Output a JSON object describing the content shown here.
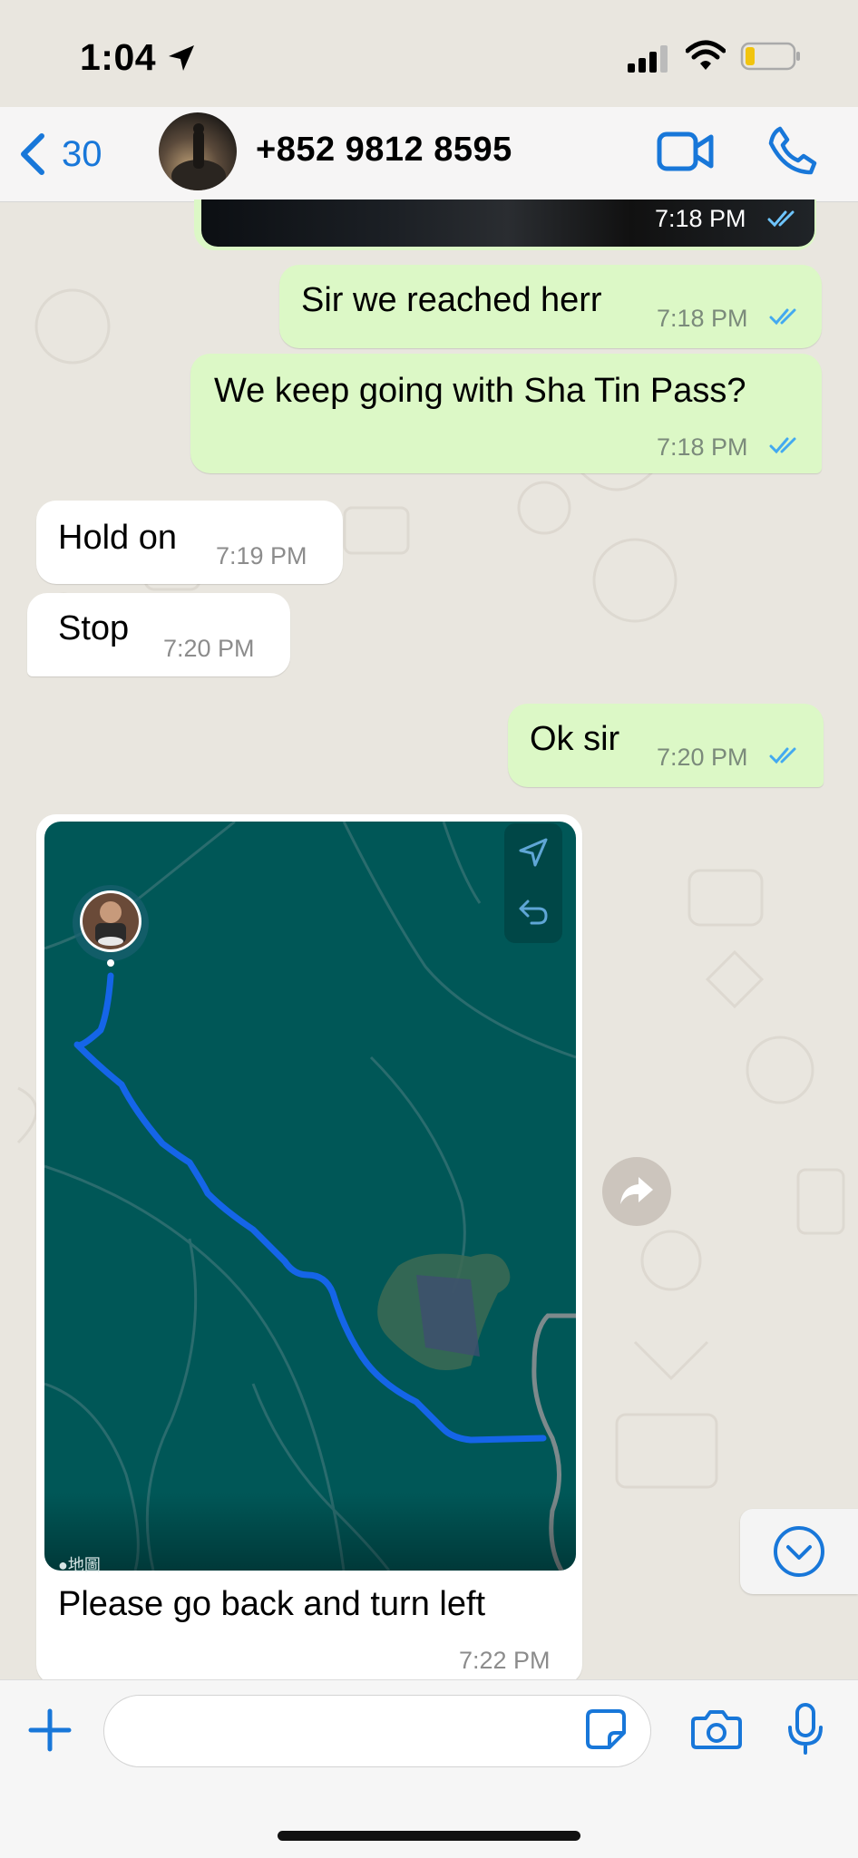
{
  "status_bar": {
    "time": "1:04"
  },
  "header": {
    "back_count": "30",
    "contact_name": "+852 9812 8595"
  },
  "messages": [
    {
      "id": "m0",
      "dir": "out",
      "type": "image",
      "time": "7:18 PM",
      "read": true
    },
    {
      "id": "m1",
      "dir": "out",
      "text": "Sir we reached herr",
      "time": "7:18 PM",
      "read": true
    },
    {
      "id": "m2",
      "dir": "out",
      "text": "We keep going with Sha Tin Pass?",
      "time": "7:18 PM",
      "read": true
    },
    {
      "id": "m3",
      "dir": "in",
      "text": "Hold on",
      "time": "7:19 PM"
    },
    {
      "id": "m4",
      "dir": "in",
      "text": "Stop",
      "time": "7:20 PM"
    },
    {
      "id": "m5",
      "dir": "out",
      "text": "Ok sir",
      "time": "7:20 PM",
      "read": true
    },
    {
      "id": "m6",
      "dir": "in",
      "type": "map-image",
      "caption": "Please go back and turn left",
      "time": "7:22 PM",
      "map_brand": "地圖"
    }
  ],
  "composer": {
    "placeholder": ""
  },
  "colors": {
    "accent": "#1877d9",
    "outgoing_bubble": "#dcf8c6",
    "route": "#1565e8",
    "map_water": "#005757"
  }
}
